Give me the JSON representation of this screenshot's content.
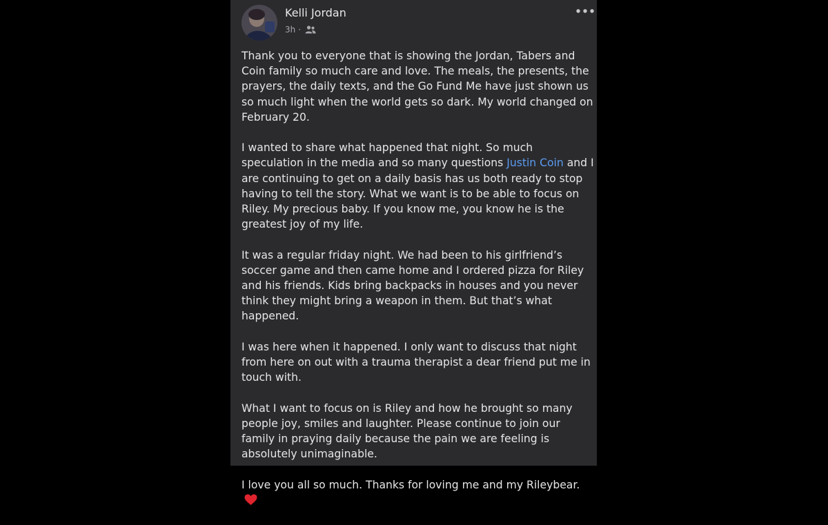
{
  "post": {
    "author": "Kelli Jordan",
    "time": "3h",
    "separator": "·",
    "audience_icon": "friends-icon",
    "more_icon": "more-options-icon",
    "paragraphs": {
      "p1": "Thank you to everyone that is showing the Jordan, Tabers and Coin family so much care and love. The meals, the presents, the prayers, the daily texts, and the Go Fund Me have just shown us so much light when the world gets so dark. My world changed on February 20.",
      "p2_before": "I wanted to share what happened that night. So much speculation in the media and so many questions ",
      "p2_mention": "Justin Coin",
      "p2_after": " and I are continuing to get on a daily basis has us both ready to stop having to tell the story. What we want is to be able to focus on Riley. My precious baby. If you know me, you know he is the greatest joy of my life.",
      "p3": "It was a regular friday night. We had been to his girlfriend’s soccer game and then came home and I ordered pizza for Riley and his friends. Kids bring backpacks in houses and you never think they might bring a weapon in them. But that’s what happened.",
      "p4": "I was here when it happened. I only want to discuss that night from here on out with a trauma therapist a dear friend put me in touch with.",
      "p5": "What I want to focus on is Riley and how he brought so many people joy, smiles and laughter. Please continue to join our family in praying daily because the pain we are feeling is absolutely unimaginable.",
      "p6": "I love you all so much. Thanks for loving me and my Rileybear.",
      "p6_emoji_icon": "red-heart-icon"
    }
  },
  "colors": {
    "page_background": "#000000",
    "card_background": "#2b2b2e",
    "text": "#e6e6e8",
    "secondary_text": "#a8a8ad",
    "link": "#5b9bf0",
    "heart": "#e0242e"
  }
}
